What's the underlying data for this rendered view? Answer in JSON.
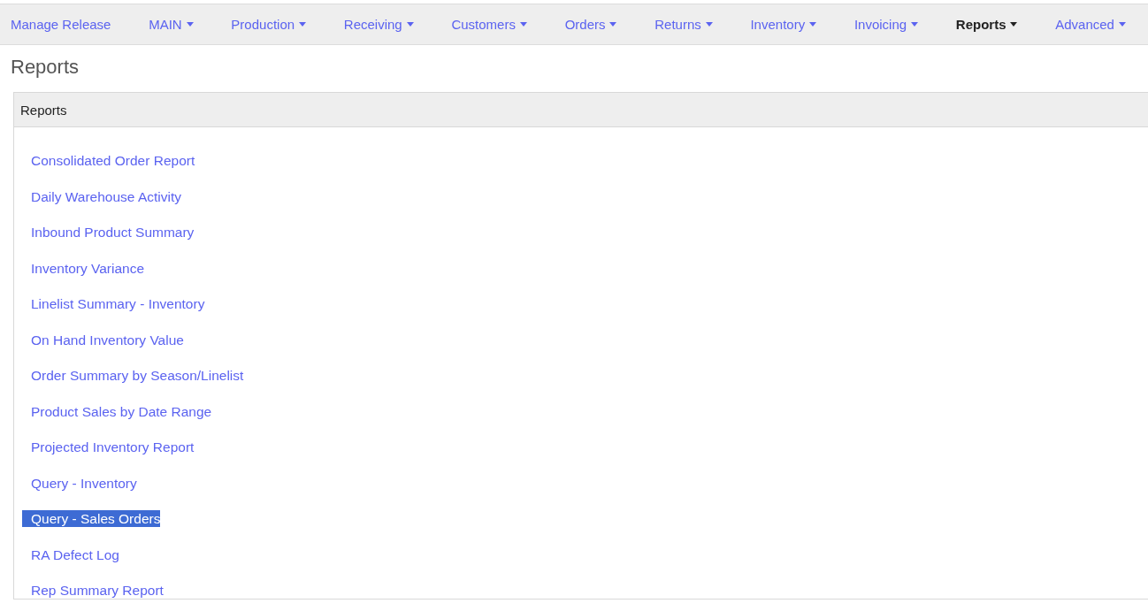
{
  "nav": [
    {
      "label": "Manage Release",
      "dropdown": false,
      "selected": false
    },
    {
      "label": "MAIN",
      "dropdown": true,
      "selected": false
    },
    {
      "label": "Production",
      "dropdown": true,
      "selected": false
    },
    {
      "label": "Receiving",
      "dropdown": true,
      "selected": false
    },
    {
      "label": "Customers",
      "dropdown": true,
      "selected": false
    },
    {
      "label": "Orders",
      "dropdown": true,
      "selected": false
    },
    {
      "label": "Returns",
      "dropdown": true,
      "selected": false
    },
    {
      "label": "Inventory",
      "dropdown": true,
      "selected": false
    },
    {
      "label": "Invoicing",
      "dropdown": true,
      "selected": false
    },
    {
      "label": "Reports",
      "dropdown": true,
      "selected": true
    },
    {
      "label": "Advanced",
      "dropdown": true,
      "selected": false
    }
  ],
  "page_title": "Reports",
  "card": {
    "header": "Reports",
    "links": [
      {
        "label": "Consolidated Order Report",
        "selected": false
      },
      {
        "label": "Daily Warehouse Activity",
        "selected": false
      },
      {
        "label": "Inbound Product Summary",
        "selected": false
      },
      {
        "label": "Inventory Variance",
        "selected": false
      },
      {
        "label": "Linelist Summary - Inventory",
        "selected": false
      },
      {
        "label": "On Hand Inventory Value",
        "selected": false
      },
      {
        "label": "Order Summary by Season/Linelist",
        "selected": false
      },
      {
        "label": "Product Sales by Date Range",
        "selected": false
      },
      {
        "label": "Projected Inventory Report",
        "selected": false
      },
      {
        "label": "Query - Inventory",
        "selected": false
      },
      {
        "label": "Query - Sales Orders",
        "selected": true
      },
      {
        "label": "RA Defect Log",
        "selected": false
      },
      {
        "label": "Rep Summary Report",
        "selected": false
      }
    ]
  }
}
